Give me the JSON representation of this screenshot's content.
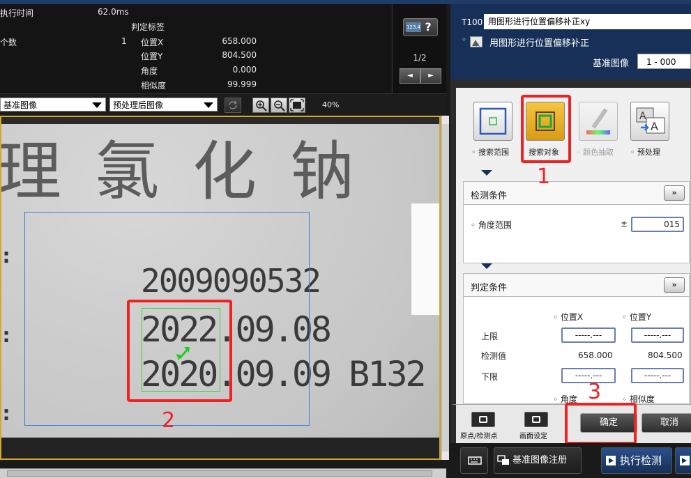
{
  "info": {
    "exec_time_label": "执行时间",
    "exec_time_value": "62.0ms",
    "judge_label": "判定标签",
    "count_label": "个数",
    "count_value": "1",
    "posx_label": "位置X",
    "posx_value": "658.000",
    "posy_label": "位置Y",
    "posy_value": "804.500",
    "angle_label": "角度",
    "angle_value": "0.000",
    "sim_label": "相似度",
    "sim_value": "99.999"
  },
  "page": {
    "btn_icon_text": "123.4",
    "btn_help": "?",
    "indicator": "1/2",
    "prev": "◄",
    "next": "►"
  },
  "toolbar": {
    "image_select": "基准图像",
    "process_select": "预处理后图像",
    "zoom": "40%"
  },
  "image": {
    "big_chars": "理氯化钠",
    "line1": "2009090532",
    "line2": "2022.09.08",
    "line3": "2020.09.09  B132",
    "colon": ":"
  },
  "annotations": {
    "one": "1",
    "two": "2",
    "three": "3"
  },
  "right": {
    "tool_id": "T100",
    "tool_title": "用图形进行位置偏移补正xy",
    "sub_title": "用图形进行位置偏移补正",
    "base_image_label": "基准图像",
    "base_image_value": "1 - 000",
    "icons": [
      {
        "label": "搜索范围"
      },
      {
        "label": "搜索对象"
      },
      {
        "label": "颜色抽取"
      },
      {
        "label": "预处理"
      }
    ],
    "detect": {
      "title": "检测条件",
      "expand": "»",
      "angle_range_label": "角度范围",
      "plusminus": "±",
      "angle_range_value": "015"
    },
    "judge": {
      "title": "判定条件",
      "expand": "»",
      "col_x": "位置X",
      "col_y": "位置Y",
      "upper": "上限",
      "detected": "检测值",
      "lower": "下限",
      "upper_x": "-----.---",
      "upper_y": "-----.---",
      "detected_x": "658.000",
      "detected_y": "804.500",
      "lower_x": "-----.---",
      "lower_y": "-----.---",
      "col_angle": "角度",
      "col_sim": "相似度"
    },
    "bottom": {
      "origin_label": "原点/检测点",
      "screen_label": "画面设定",
      "ok": "确定",
      "cancel": "取消"
    },
    "bar": {
      "register": "基准图像注册",
      "run": "执行检测"
    }
  },
  "colors": {
    "accent": "#163057",
    "highlight": "#ee2222",
    "search_range": "#3e7fd8",
    "search_target": "#39d639",
    "active_btn": "#f0b429"
  }
}
